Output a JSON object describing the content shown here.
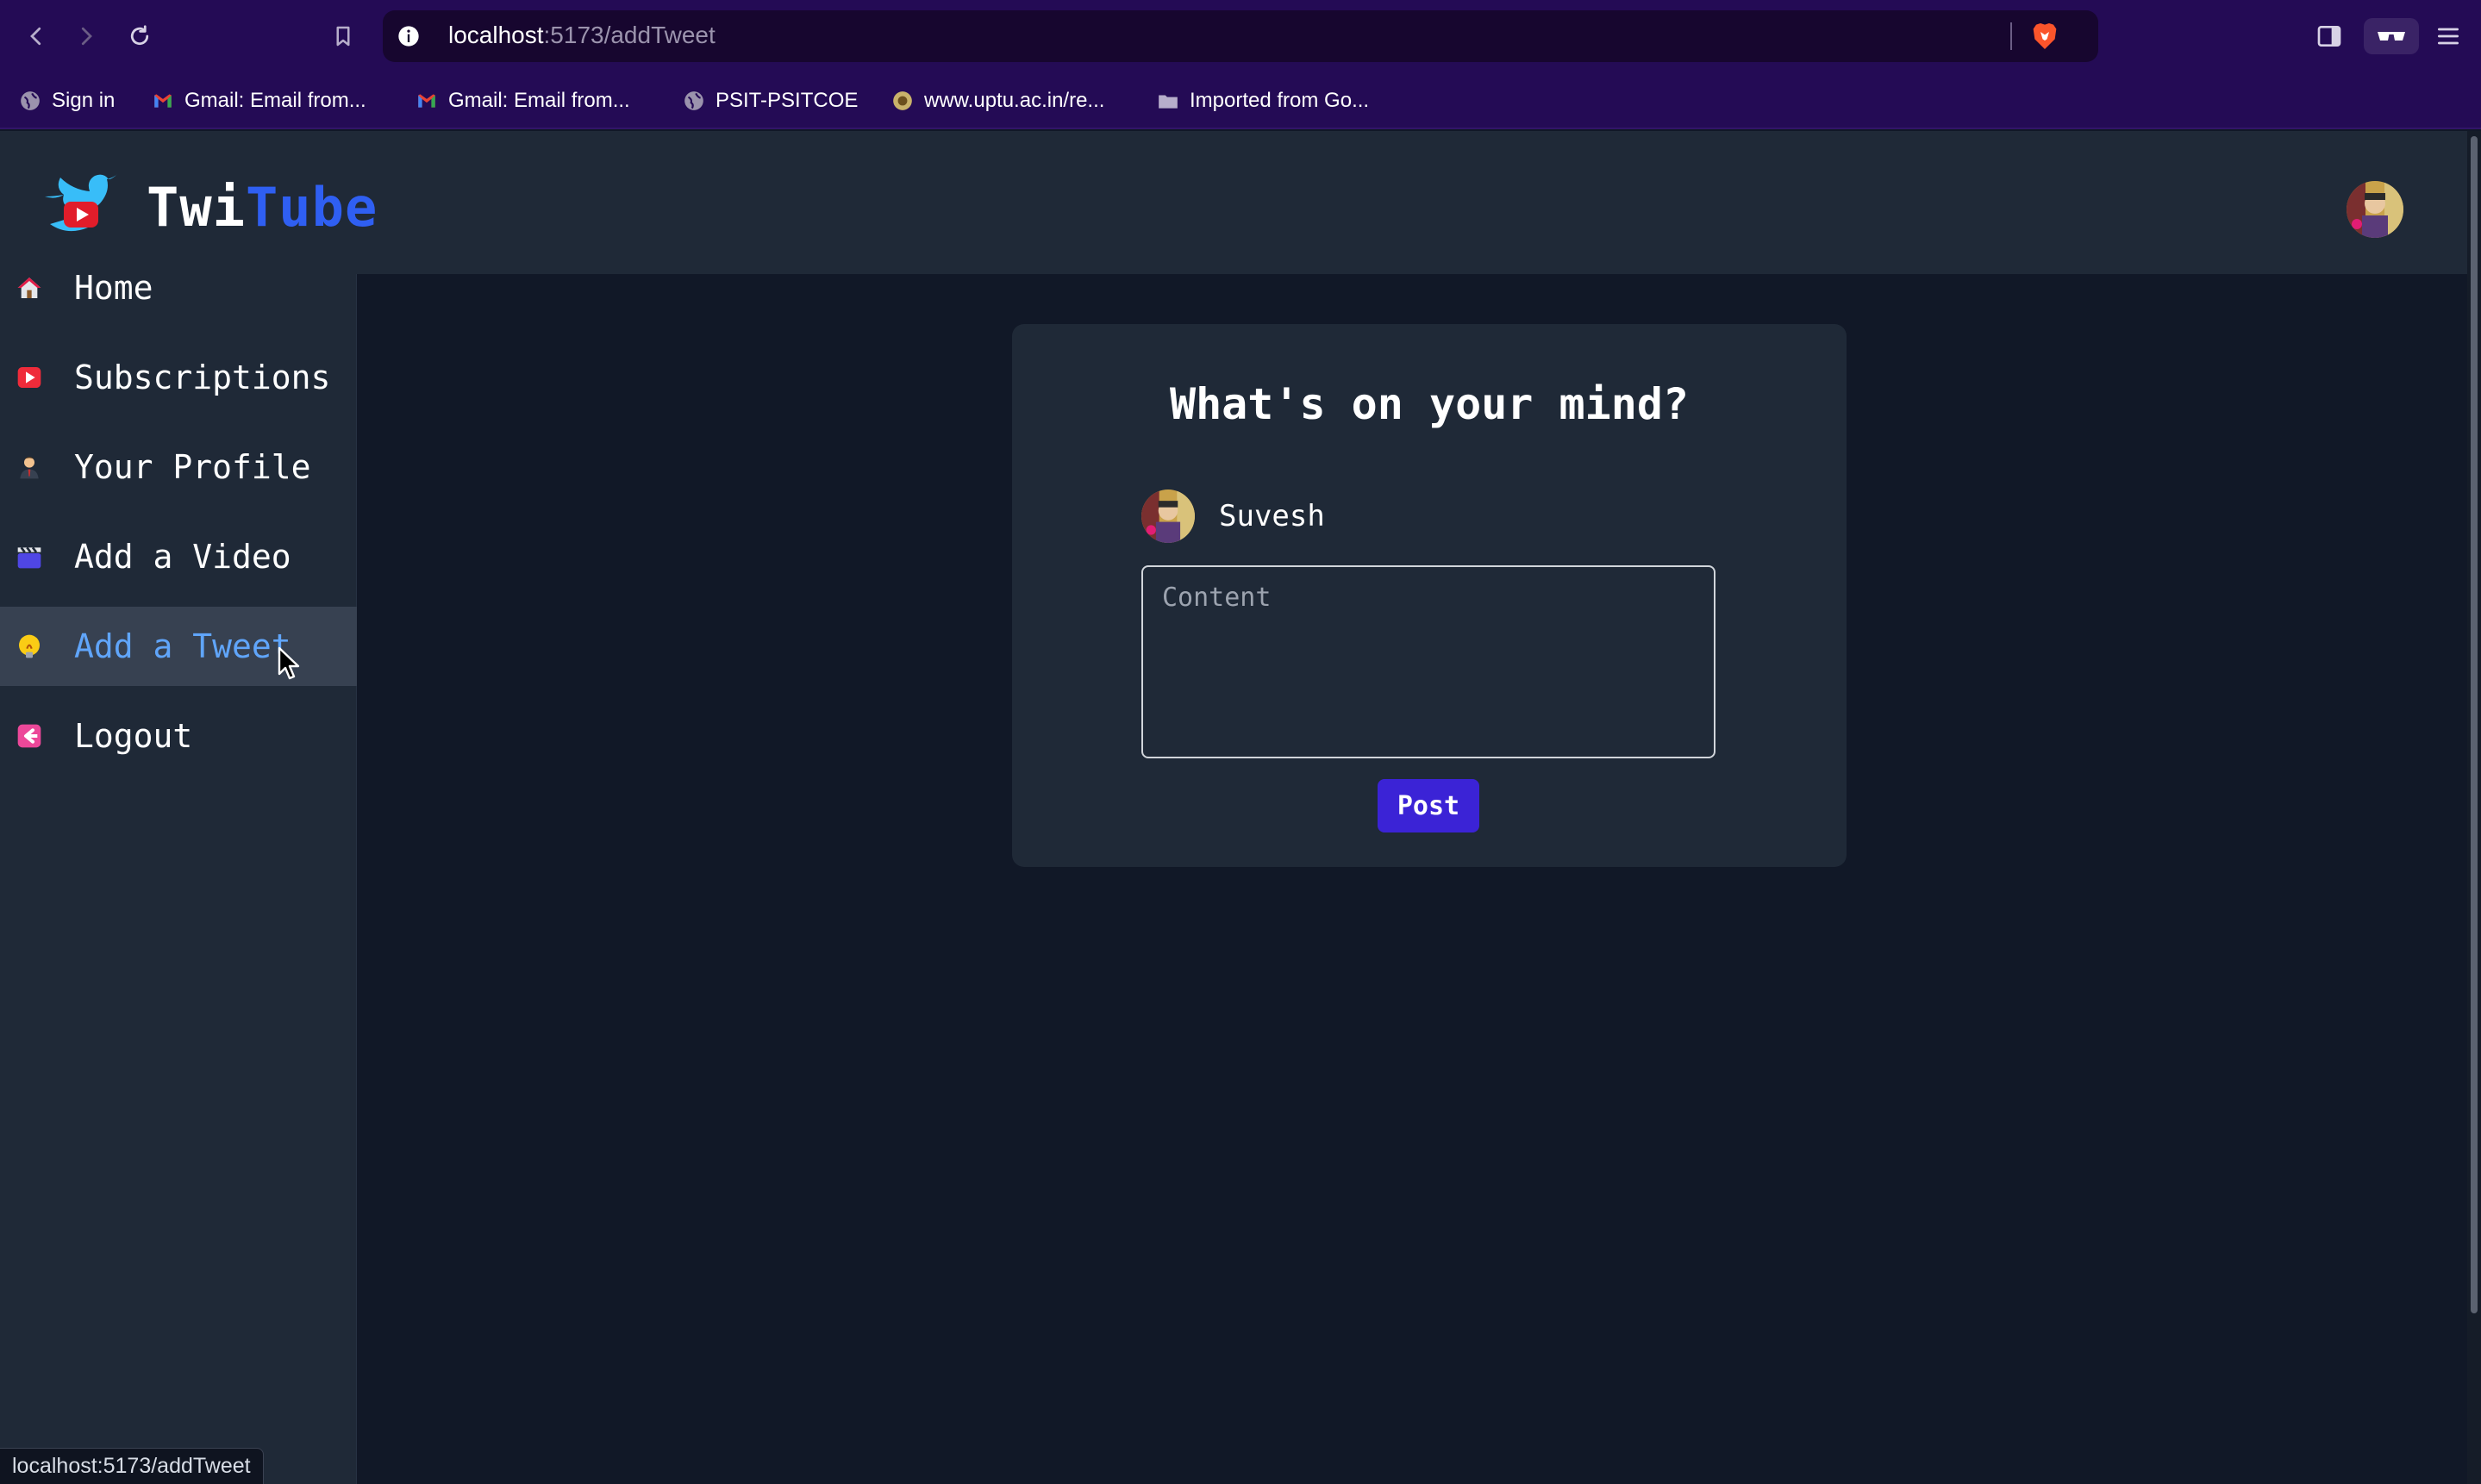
{
  "browser": {
    "url_host": "localhost",
    "url_path": ":5173/addTweet",
    "bookmarks": [
      {
        "label": "Sign in",
        "icon": "globe-icon"
      },
      {
        "label": "Gmail: Email from...",
        "icon": "gmail-icon"
      },
      {
        "label": "Gmail: Email from...",
        "icon": "gmail-icon"
      },
      {
        "label": "PSIT-PSITCOE",
        "icon": "globe-icon"
      },
      {
        "label": "www.uptu.ac.in/re...",
        "icon": "site-icon"
      },
      {
        "label": "Imported from Go...",
        "icon": "folder-icon"
      }
    ],
    "status_url": "localhost:5173/addTweet"
  },
  "app": {
    "brand_part1": "Twi",
    "brand_part2": "Tube",
    "colors": {
      "brand_blue": "#2f5ff2",
      "active_link": "#60a5fa",
      "post_button": "#3b23d6"
    }
  },
  "sidebar": {
    "items": [
      {
        "label": "Home",
        "icon": "house-icon"
      },
      {
        "label": "Subscriptions",
        "icon": "play-button-icon"
      },
      {
        "label": "Your Profile",
        "icon": "person-icon"
      },
      {
        "label": "Add a Video",
        "icon": "clapper-board-icon"
      },
      {
        "label": "Add a Tweet",
        "icon": "lightbulb-icon",
        "active": true
      },
      {
        "label": "Logout",
        "icon": "logout-icon"
      }
    ]
  },
  "form": {
    "title": "What's on your mind?",
    "username": "Suvesh",
    "content_placeholder": "Content",
    "content_value": "",
    "post_label": "Post"
  }
}
